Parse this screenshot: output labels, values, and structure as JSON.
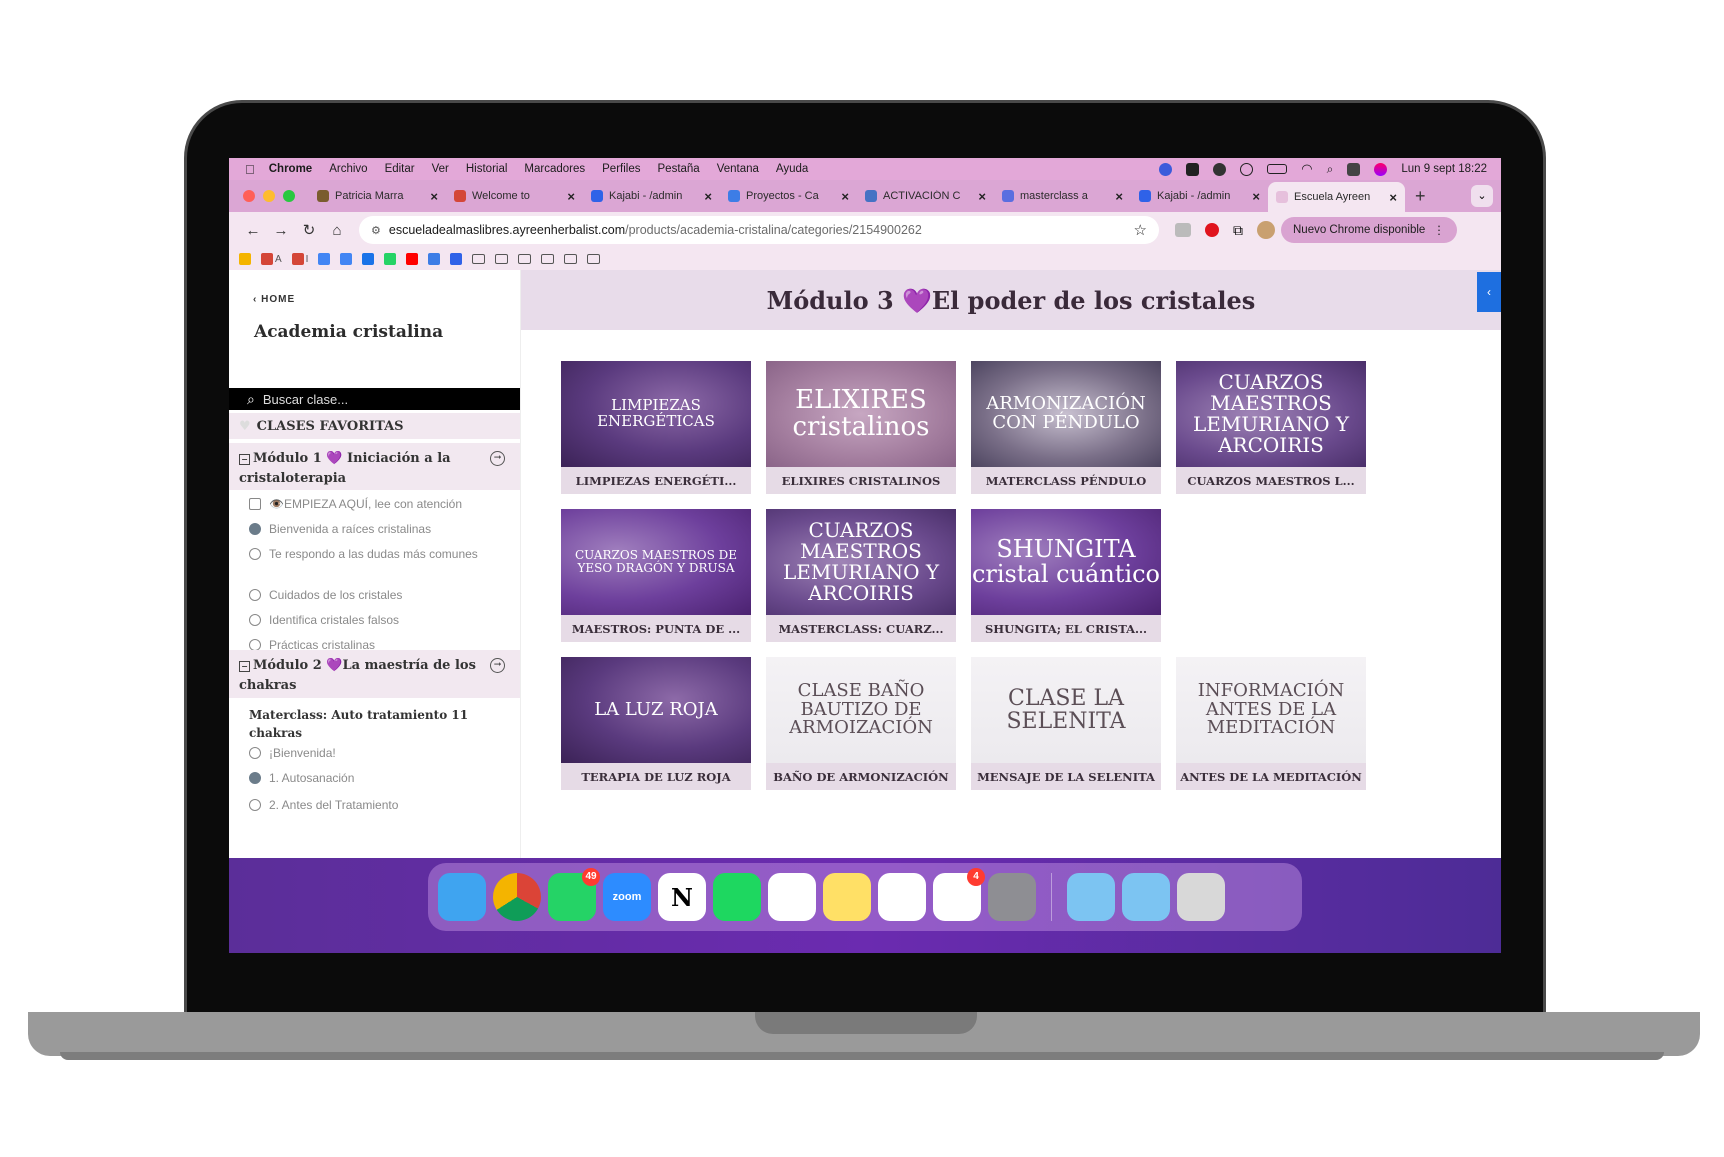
{
  "menubar": {
    "apple": "",
    "app": "Chrome",
    "items": [
      "Archivo",
      "Editar",
      "Ver",
      "Historial",
      "Marcadores",
      "Perfiles",
      "Pestaña",
      "Ventana",
      "Ayuda"
    ],
    "clock": "Lun 9 sept 18:22"
  },
  "tabs": [
    {
      "title": "Patricia Marra",
      "favicon": "asterisk-icon",
      "color": "#7a5c2e"
    },
    {
      "title": "Welcome to",
      "favicon": "gmail-icon",
      "color": "#d44638"
    },
    {
      "title": "Kajabi - /admin",
      "favicon": "kajabi-icon",
      "color": "#2f62e8"
    },
    {
      "title": "Proyectos - Ca",
      "favicon": "canva-icon",
      "color": "#3d7de6"
    },
    {
      "title": "ACTIVACIÓN C",
      "favicon": "doc-icon",
      "color": "#4472c4"
    },
    {
      "title": "masterclass a",
      "favicon": "chat-icon",
      "color": "#5a6ee0"
    },
    {
      "title": "Kajabi - /admin",
      "favicon": "kajabi-icon",
      "color": "#2f62e8"
    },
    {
      "title": "Escuela Ayreen",
      "favicon": "flower-icon",
      "color": "#e6c0dc",
      "active": true
    }
  ],
  "toolbar": {
    "url_domain": "escuelad­ealmaslibres.ayreenherbalist.com",
    "url_path": "/products/academia-cristalina/categories/2154900262",
    "update_label": "Nuevo Chrome disponible"
  },
  "bookmarks": [
    {
      "type": "icon",
      "label": "",
      "color": "#f4b400"
    },
    {
      "type": "icon",
      "label": "A",
      "color": "#d44638"
    },
    {
      "type": "icon",
      "label": "I",
      "color": "#d44638"
    },
    {
      "type": "icon",
      "label": "",
      "color": "#4285f4"
    },
    {
      "type": "icon",
      "label": "",
      "color": "#4285f4"
    },
    {
      "type": "icon",
      "label": "",
      "color": "#1a73e8"
    },
    {
      "type": "icon",
      "label": "",
      "color": "#25d366"
    },
    {
      "type": "icon",
      "label": "",
      "color": "#ff0000"
    },
    {
      "type": "icon",
      "label": "",
      "color": "#3d7de6"
    },
    {
      "type": "icon",
      "label": "",
      "color": "#2f62e8"
    },
    {
      "type": "folder",
      "label": "",
      "color": "#555"
    },
    {
      "type": "folder",
      "label": "",
      "color": "#555"
    },
    {
      "type": "folder",
      "label": "",
      "color": "#555"
    },
    {
      "type": "folder",
      "label": "",
      "color": "#555"
    },
    {
      "type": "folder",
      "label": "",
      "color": "#555"
    },
    {
      "type": "folder",
      "label": "",
      "color": "#555"
    }
  ],
  "sidebar": {
    "home": "HOME",
    "course_title": "Academia cristalina",
    "search_placeholder": "Buscar clase...",
    "favorites": "CLASES FAVORITAS",
    "module1": "Módulo 1 💜 Iniciación a la cristaloterapia",
    "module1_lessons": [
      {
        "label": "👁️EMPIEZA AQUÍ, lee con atención",
        "state": "doc"
      },
      {
        "label": "Bienvenida a raíces cristalinas",
        "state": "done"
      },
      {
        "label": "Te respondo a las dudas más comunes",
        "state": "play"
      },
      {
        "label": "Cuidados de los cristales",
        "state": "play"
      },
      {
        "label": "Identifica cristales falsos",
        "state": "play"
      },
      {
        "label": "Prácticas cristalinas",
        "state": "play"
      }
    ],
    "module2": "Módulo 2 💜La maestría de los chakras",
    "module2_subhead": "Materclass: Auto tratamiento 11 chakras",
    "module2_lessons": [
      {
        "label": "¡Bienvenida!",
        "state": "play"
      },
      {
        "label": "1. Autosanación",
        "state": "done"
      },
      {
        "label": "2. Antes del Tratamiento",
        "state": "play"
      }
    ]
  },
  "main": {
    "title": "Módulo 3 💜El poder de los cristales",
    "cards": [
      {
        "img_text": "LIMPIEZAS ENERGÉTICAS",
        "label": "LIMPIEZAS ENERGÉTI...",
        "style": "purple",
        "fs": "15px"
      },
      {
        "img_text": "ELIXIRES cristalinos",
        "label": "ELIXIRES CRISTALINOS",
        "style": "mauve",
        "fs": "26px"
      },
      {
        "img_text": "ARMONIZACIÓN CON PÉNDULO",
        "label": "MATERCLASS PÉNDULO",
        "style": "silver",
        "fs": "18px"
      },
      {
        "img_text": "CUARZOS MAESTROS LEMURIANO Y ARCOIRIS",
        "label": "CUARZOS MAESTROS L...",
        "style": "violet",
        "fs": "20px"
      },
      {
        "img_text": "CUARZOS MAESTROS DE YESO DRAGÓN Y DRUSA",
        "label": "MAESTROS: PUNTA DE ...",
        "style": "deep",
        "fs": "12px"
      },
      {
        "img_text": "CUARZOS MAESTROS LEMURIANO Y ARCOIRIS",
        "label": "MASTERCLASS: CUARZ...",
        "style": "violet",
        "fs": "20px"
      },
      {
        "img_text": "SHUNGITA cristal cuántico",
        "label": "SHUNGITA; EL CRISTA...",
        "style": "deep",
        "fs": "24px"
      },
      {
        "img_text": "LA LUZ ROJA",
        "label": "TERAPIA DE LUZ ROJA",
        "style": "purple",
        "fs": "18px"
      },
      {
        "img_text": "CLASE BAÑO BAUTIZO DE ARMOIZACIÓN",
        "label": "BAÑO DE ARMONIZACIÓN",
        "style": "pale",
        "fs": "18px"
      },
      {
        "img_text": "CLASE LA SELENITA",
        "label": "MENSAJE DE LA SELENITA",
        "style": "pale",
        "fs": "22px"
      },
      {
        "img_text": "INFORMACIÓN ANTES DE LA MEDITACIÓN",
        "label": "ANTES DE LA MEDITACIÓN",
        "style": "pale",
        "fs": "18px"
      }
    ]
  },
  "dock": [
    {
      "name": "finder-icon",
      "bg": "#3fa4f0",
      "text": ""
    },
    {
      "name": "chrome-icon",
      "bg": "#ffffff",
      "text": ""
    },
    {
      "name": "whatsapp-icon",
      "bg": "#25d366",
      "text": "",
      "badge": "49"
    },
    {
      "name": "zoom-icon",
      "bg": "#2d8cff",
      "text": "zoom"
    },
    {
      "name": "notion-icon",
      "bg": "#ffffff",
      "text": "N"
    },
    {
      "name": "spotify-icon",
      "bg": "#1ed760",
      "text": ""
    },
    {
      "name": "photos-icon",
      "bg": "#ffffff",
      "text": ""
    },
    {
      "name": "notes-icon",
      "bg": "#ffe066",
      "text": ""
    },
    {
      "name": "freeform-icon",
      "bg": "#ffffff",
      "text": ""
    },
    {
      "name": "reminders-icon",
      "bg": "#ffffff",
      "text": "",
      "badge": "4"
    },
    {
      "name": "settings-icon",
      "bg": "#8e8e93",
      "text": ""
    },
    {
      "name": "sep",
      "bg": "",
      "text": ""
    },
    {
      "name": "applications-folder-icon",
      "bg": "#7cc4f2",
      "text": ""
    },
    {
      "name": "downloads-folder-icon",
      "bg": "#7cc4f2",
      "text": ""
    },
    {
      "name": "trash-icon",
      "bg": "#d8d8d8",
      "text": ""
    }
  ]
}
